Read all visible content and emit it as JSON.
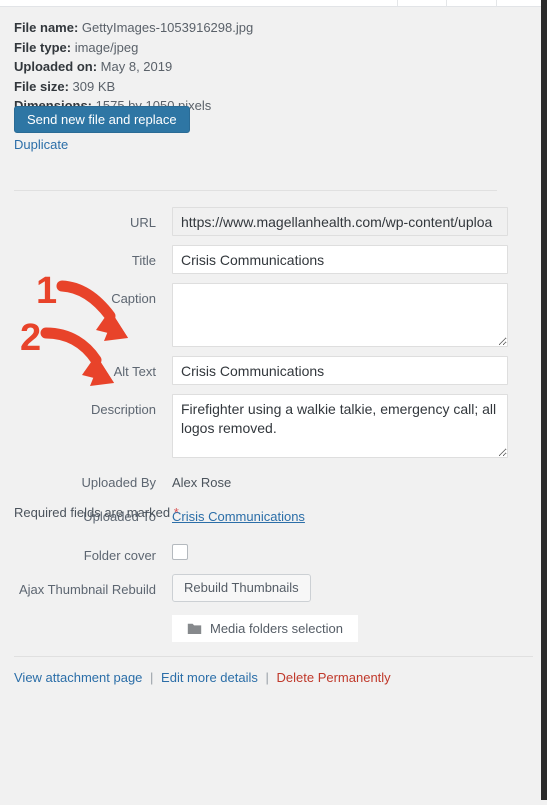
{
  "window": {
    "background_color": "#f1f1f1",
    "accent_blue": "#2e76a4",
    "link_blue": "#2b6ea8",
    "danger_red": "#c0392b",
    "annotation_red": "#e8432a"
  },
  "file_info": {
    "rows": [
      {
        "key": "File name:",
        "value": "GettyImages-1053916298.jpg"
      },
      {
        "key": "File type:",
        "value": "image/jpeg"
      },
      {
        "key": "Uploaded on:",
        "value": "May 8, 2019"
      },
      {
        "key": "File size:",
        "value": "309 KB"
      },
      {
        "key": "Dimensions:",
        "value": "1575 by 1050 pixels"
      }
    ],
    "replace_button": "Send new file and replace",
    "duplicate_link": "Duplicate"
  },
  "fields": {
    "url": {
      "label": "URL",
      "value": "https://www.magellanhealth.com/wp-content/uploa",
      "placeholder": ""
    },
    "title": {
      "label": "Title",
      "value": "Crisis Communications",
      "placeholder": ""
    },
    "caption": {
      "label": "Caption",
      "value": "",
      "placeholder": ""
    },
    "alt_text": {
      "label": "Alt Text",
      "value": "Crisis Communications",
      "placeholder": ""
    },
    "description": {
      "label": "Description",
      "value": "Firefighter using a walkie talkie, emergency call; all logos removed.",
      "placeholder": ""
    },
    "uploaded_by": {
      "label": "Uploaded By",
      "value": "Alex Rose"
    },
    "uploaded_to": {
      "label": "Uploaded To",
      "value": "Crisis Communications"
    }
  },
  "required_note": {
    "text": "Required fields are marked",
    "star": "*"
  },
  "plugin_rows": {
    "folder_cover": {
      "label": "Folder cover",
      "checked": false
    },
    "ajax_thumbnail_rebuild": {
      "label": "Ajax Thumbnail Rebuild",
      "button": "Rebuild Thumbnails"
    },
    "media_folders": {
      "button": "Media folders selection",
      "icon": "folder-icon"
    }
  },
  "actions": {
    "view_attachment": "View attachment page",
    "edit_more": "Edit more details",
    "delete": "Delete Permanently",
    "separator": "|"
  },
  "annotations": [
    {
      "number": "1",
      "target": "alt-text-field"
    },
    {
      "number": "2",
      "target": "description-field"
    }
  ]
}
